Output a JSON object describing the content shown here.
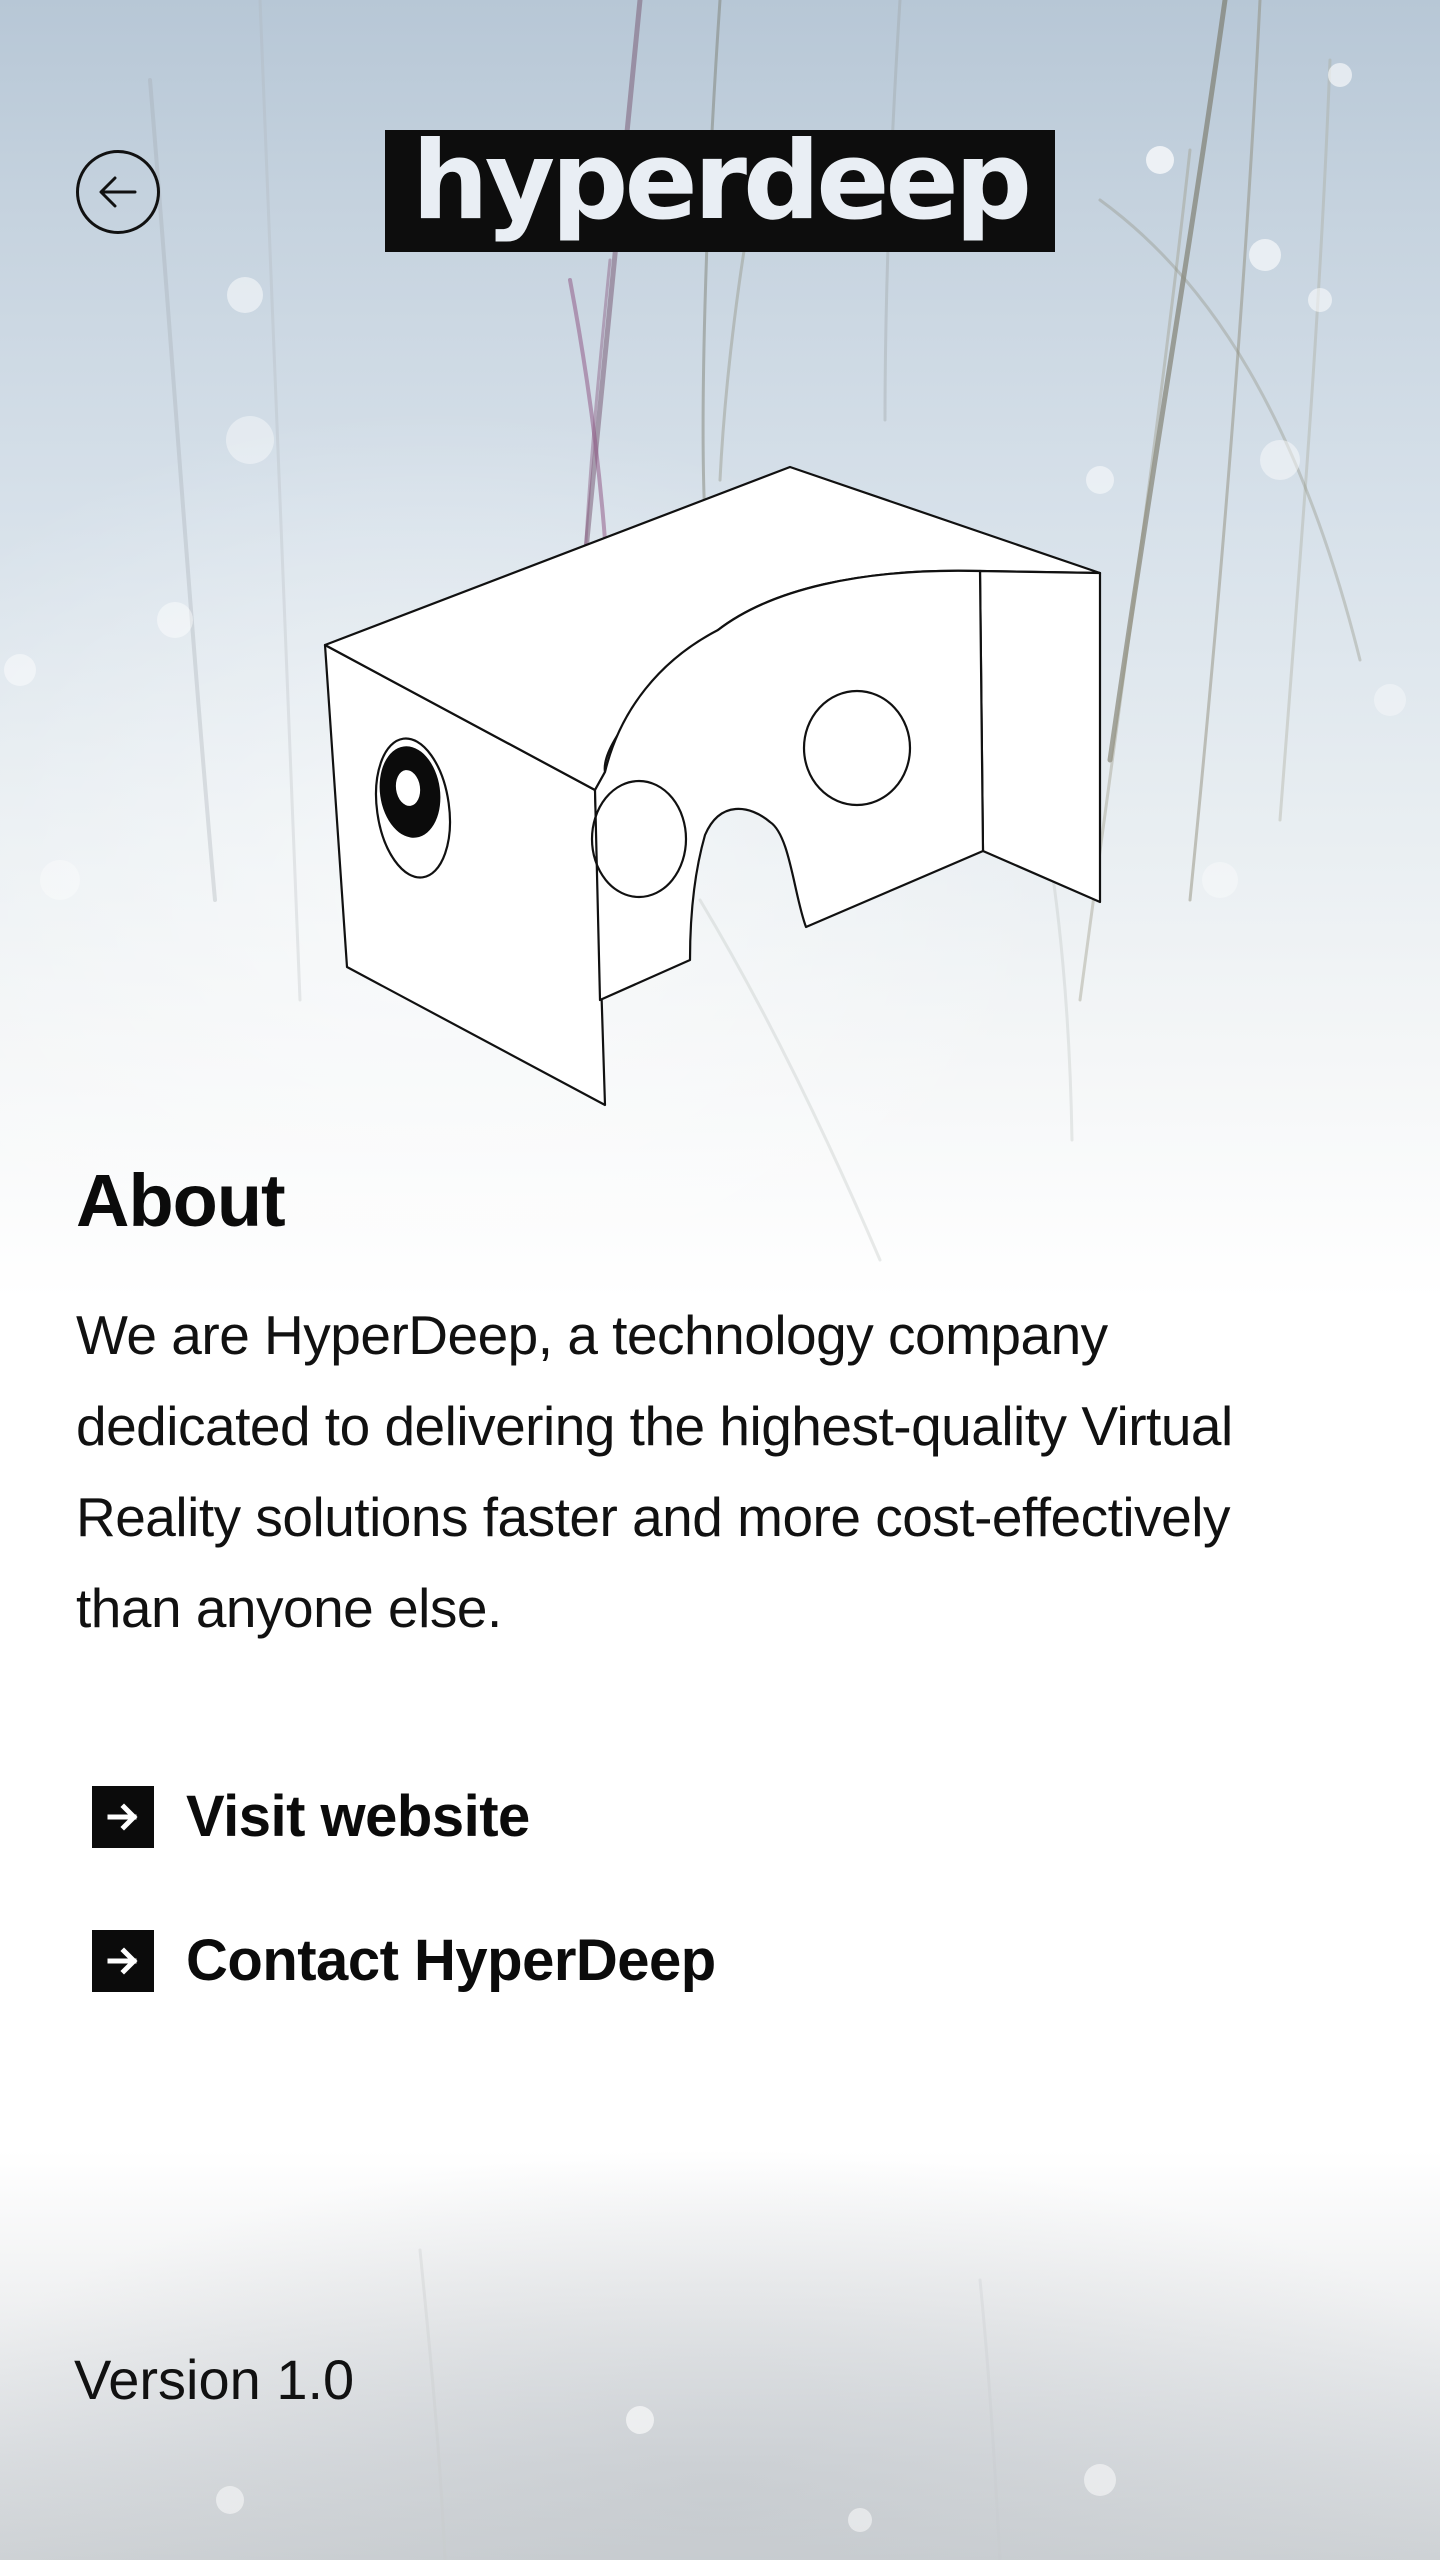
{
  "header": {
    "back_icon": "arrow-left-circle-icon",
    "logo_text": "hyperdeep"
  },
  "illustration": {
    "icon": "vr-cardboard-headset-icon"
  },
  "about": {
    "title": "About",
    "body": "We are HyperDeep, a technology company dedicated to delivering the highest-quality Virtual Reality solutions faster and more cost-effectively than anyone else."
  },
  "links": {
    "visit_website": "Visit website",
    "contact": "Contact HyperDeep",
    "icon": "arrow-right-box-icon"
  },
  "footer": {
    "version": "Version 1.0"
  },
  "colors": {
    "text": "#0b0b0b",
    "logo_background": "#0d0d0d",
    "logo_text": "#e9eef4",
    "sky_top": "#b7c7d6"
  }
}
